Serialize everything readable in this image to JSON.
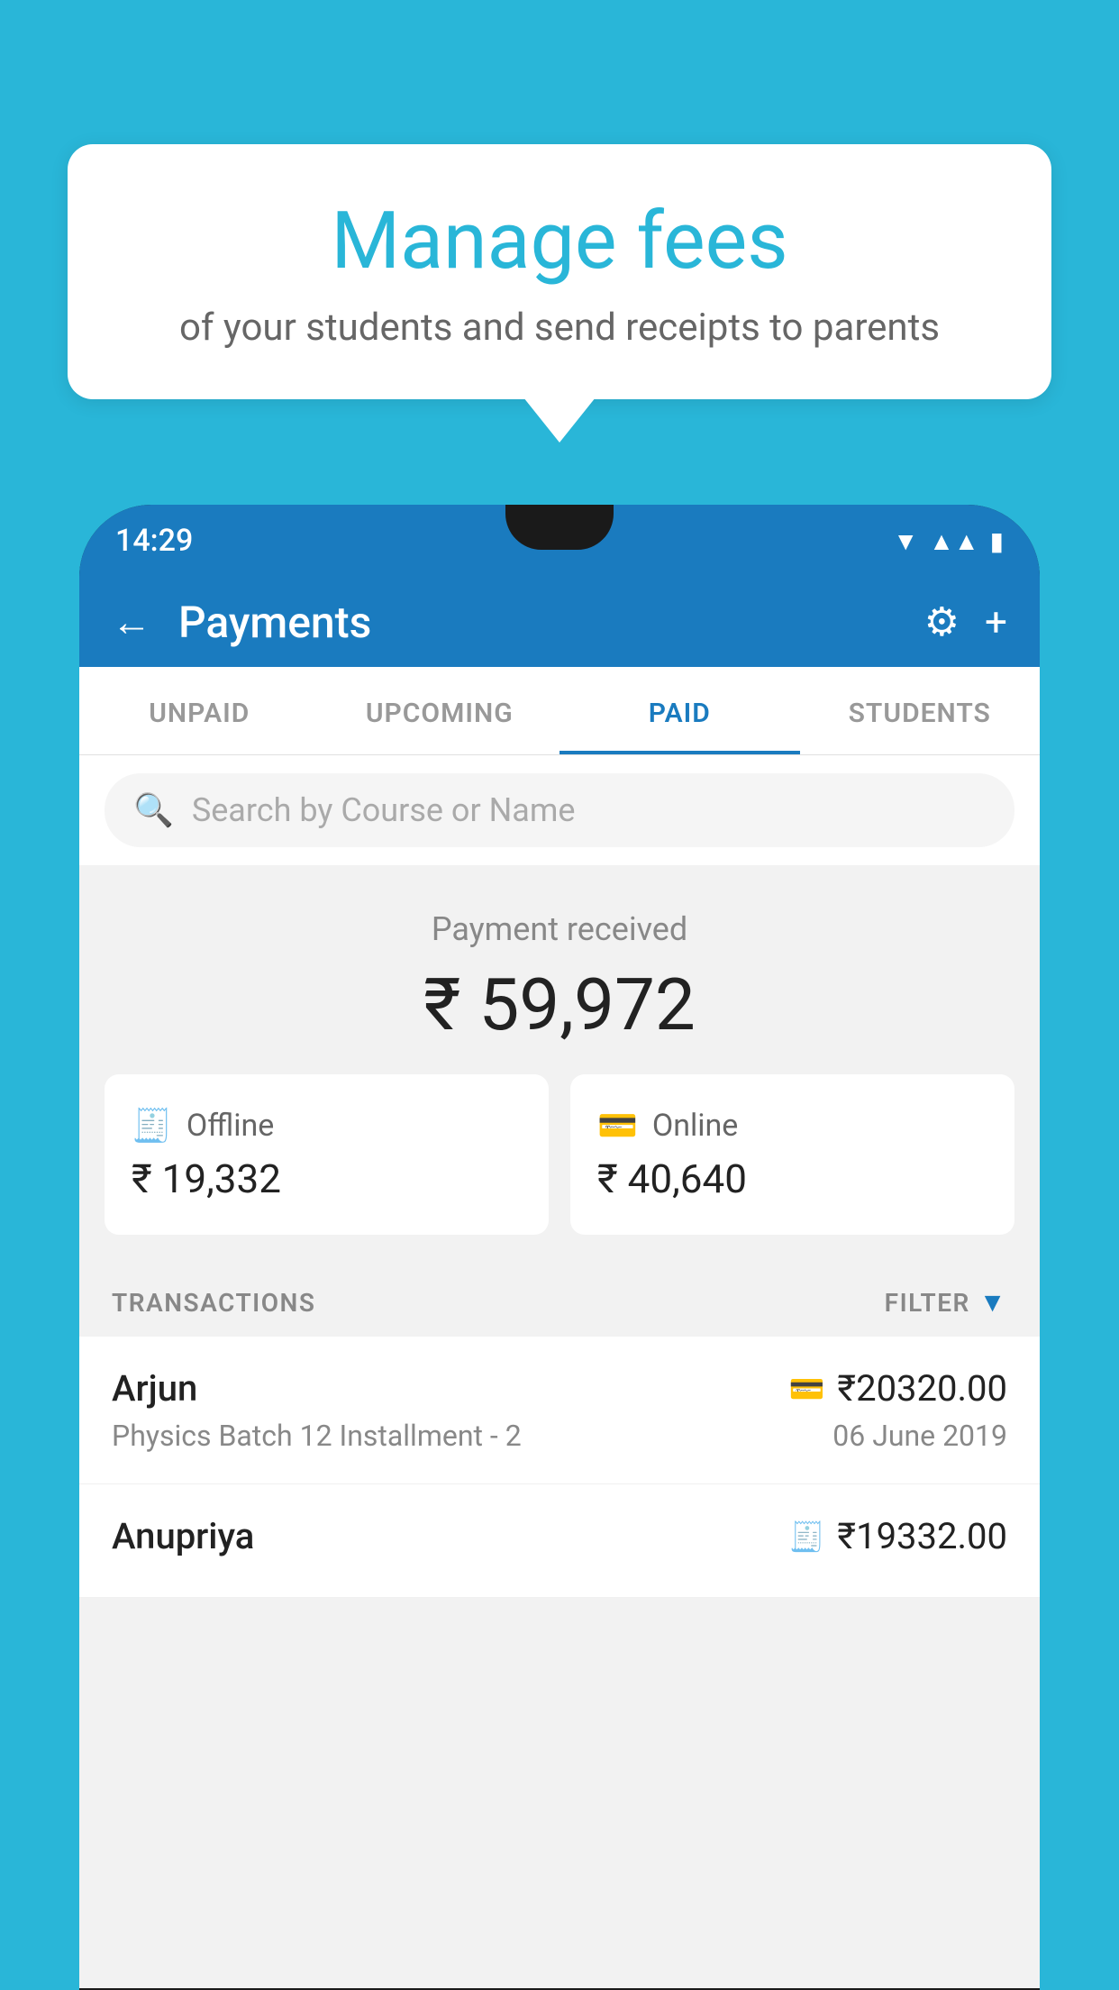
{
  "page": {
    "background_color": "#29b6d8"
  },
  "bubble": {
    "title": "Manage fees",
    "subtitle": "of your students and send receipts to parents"
  },
  "status_bar": {
    "time": "14:29",
    "icons": [
      "wifi",
      "signal",
      "battery"
    ]
  },
  "header": {
    "title": "Payments",
    "back_label": "←",
    "settings_label": "⚙",
    "add_label": "+"
  },
  "tabs": [
    {
      "label": "UNPAID",
      "active": false
    },
    {
      "label": "UPCOMING",
      "active": false
    },
    {
      "label": "PAID",
      "active": true
    },
    {
      "label": "STUDENTS",
      "active": false
    }
  ],
  "search": {
    "placeholder": "Search by Course or Name"
  },
  "payment_received": {
    "label": "Payment received",
    "amount": "₹ 59,972"
  },
  "payment_cards": [
    {
      "icon": "💳",
      "label": "Offline",
      "amount": "₹ 19,332"
    },
    {
      "icon": "💳",
      "label": "Online",
      "amount": "₹ 40,640"
    }
  ],
  "transactions": {
    "label": "TRANSACTIONS",
    "filter_label": "FILTER"
  },
  "transaction_list": [
    {
      "name": "Arjun",
      "description": "Physics Batch 12 Installment - 2",
      "amount": "₹20320.00",
      "date": "06 June 2019",
      "type": "online"
    },
    {
      "name": "Anupriya",
      "description": "",
      "amount": "₹19332.00",
      "date": "",
      "type": "offline"
    }
  ]
}
